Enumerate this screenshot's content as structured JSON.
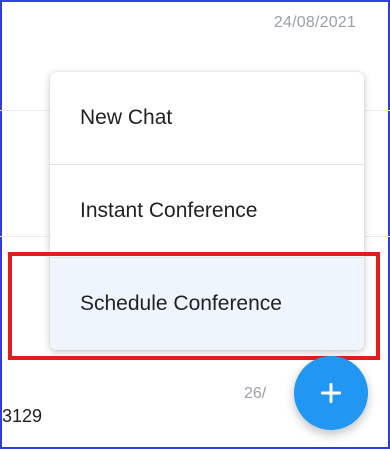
{
  "list": {
    "top_date": "24/08/2021",
    "bottom_date": "26/",
    "bottom_number": "3129"
  },
  "menu": {
    "items": [
      {
        "label": "New Chat"
      },
      {
        "label": "Instant Conference"
      },
      {
        "label": "Schedule Conference"
      }
    ]
  },
  "fab": {
    "icon": "plus-icon",
    "color": "#2196f3"
  },
  "highlight": {
    "color": "#e41b1b",
    "target": "Schedule Conference"
  }
}
